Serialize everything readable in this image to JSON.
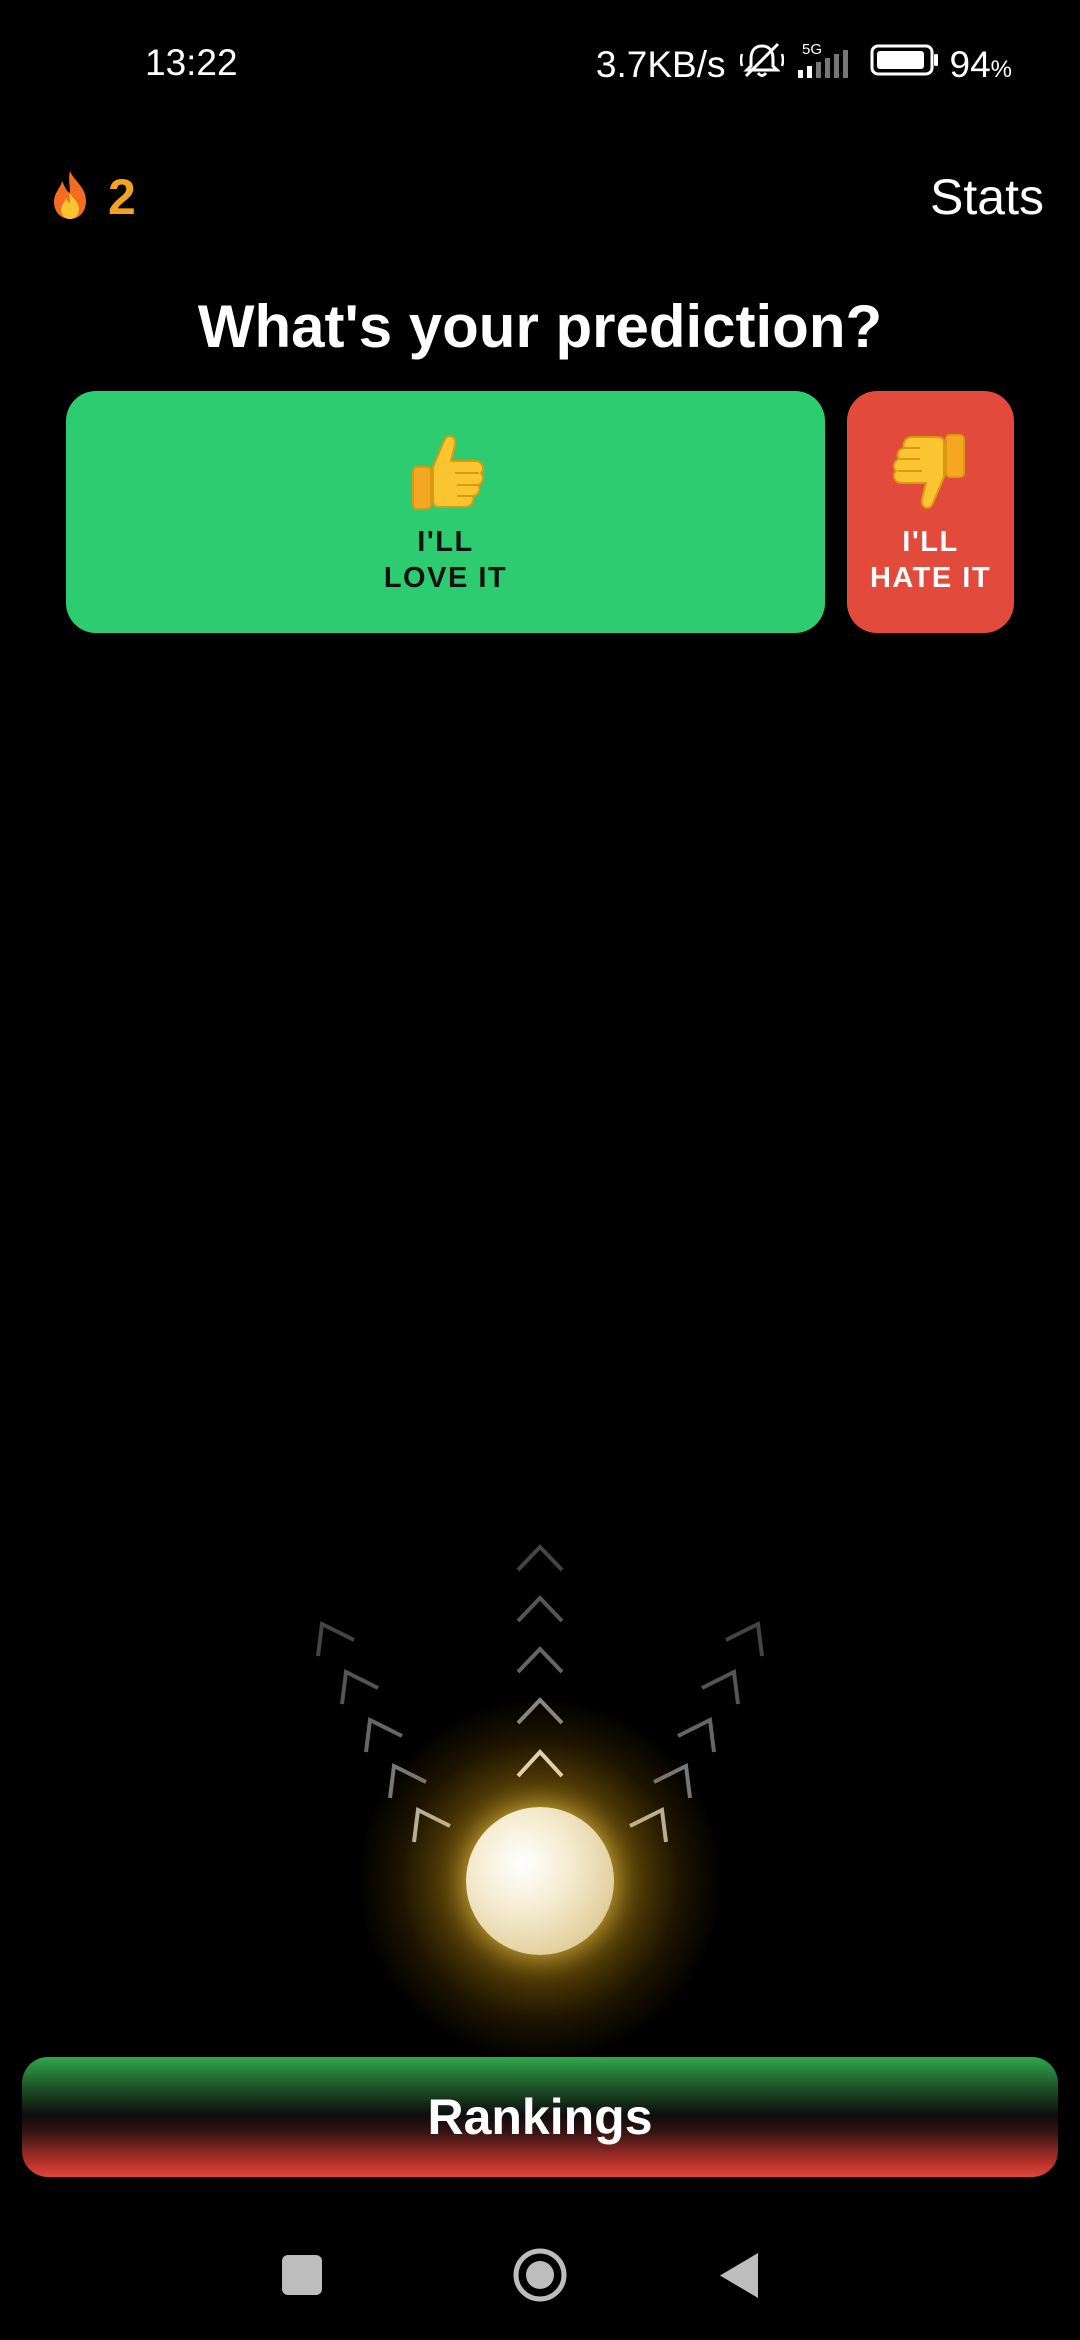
{
  "status_bar": {
    "time": "13:22",
    "net_speed": "3.7KB/s",
    "network_type": "5G",
    "battery_value": "94",
    "battery_unit": "%",
    "battery_level_percent": 94,
    "icons": [
      "mute-icon",
      "signal-icon",
      "battery-icon"
    ]
  },
  "header": {
    "streak_icon": "fire-icon",
    "streak_count": "2",
    "stats_label": "Stats"
  },
  "prediction": {
    "title": "What's your prediction?",
    "love": {
      "emoji": "👍",
      "line1": "I'LL",
      "line2": "LOVE IT"
    },
    "hate": {
      "emoji": "👎",
      "line1": "I'LL",
      "line2": "HATE IT"
    }
  },
  "swipe": {
    "icons": [
      "chevron-up-icon",
      "chevron-up-left-icon",
      "chevron-up-right-icon",
      "orb-icon"
    ]
  },
  "footer": {
    "rankings_label": "Rankings"
  },
  "nav_bar": {
    "icons": [
      "recents-square-icon",
      "home-circle-icon",
      "back-triangle-icon"
    ]
  },
  "colors": {
    "love": "#2ecc71",
    "hate": "#e24a3b",
    "streak": "#f4a321",
    "background": "#000000"
  }
}
